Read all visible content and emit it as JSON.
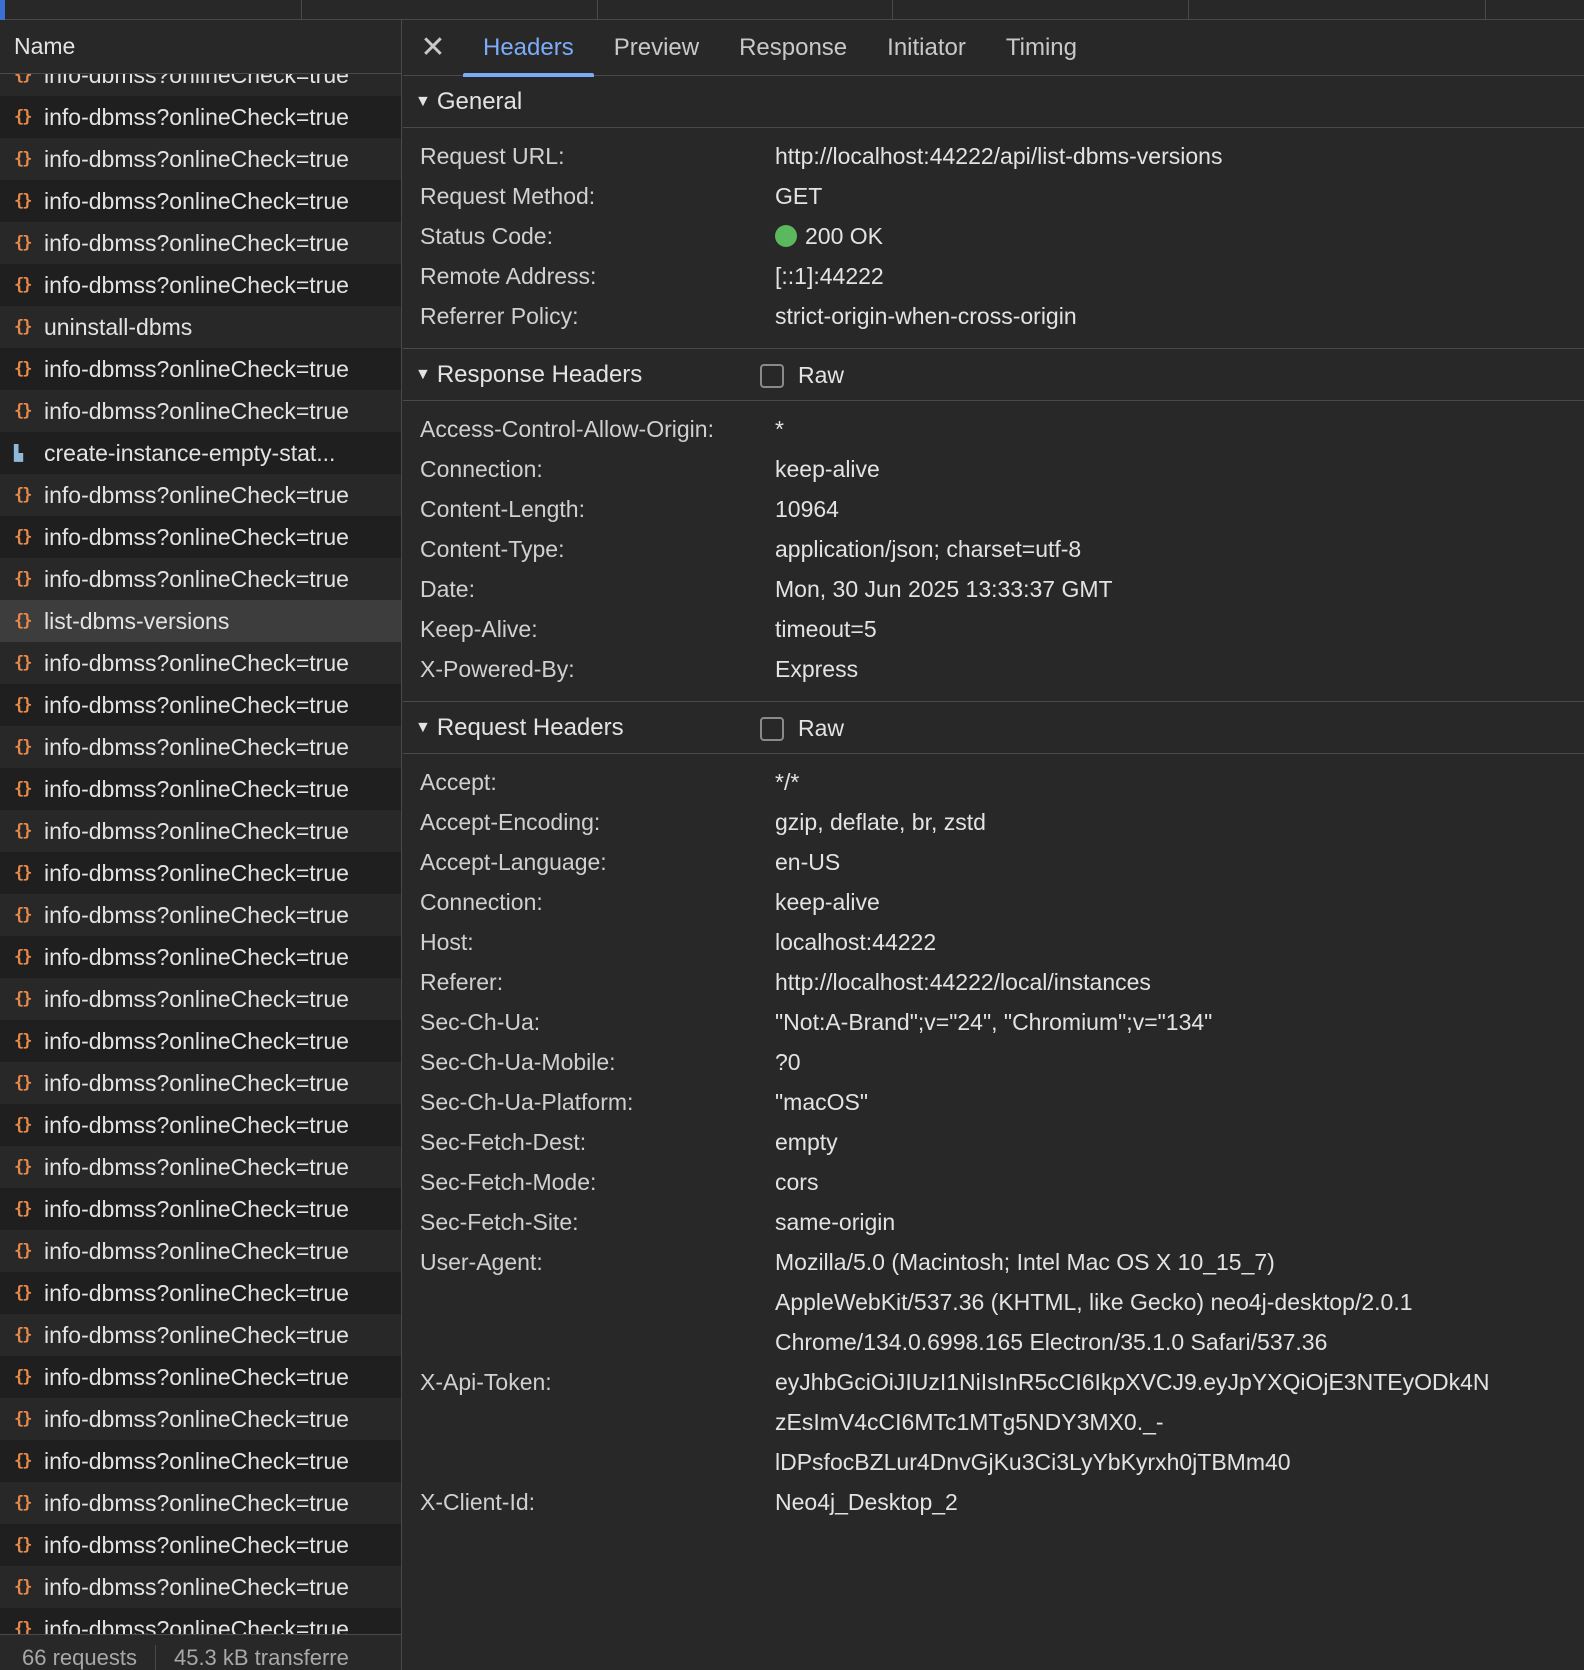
{
  "list": {
    "header": "Name",
    "partial_top": "info-dbmss?onlineCheck=true",
    "rows": [
      {
        "label": "info-dbmss?onlineCheck=true",
        "icon": "json-icon"
      },
      {
        "label": "info-dbmss?onlineCheck=true",
        "icon": "json-icon"
      },
      {
        "label": "info-dbmss?onlineCheck=true",
        "icon": "json-icon"
      },
      {
        "label": "info-dbmss?onlineCheck=true",
        "icon": "json-icon"
      },
      {
        "label": "info-dbmss?onlineCheck=true",
        "icon": "json-icon"
      },
      {
        "label": "uninstall-dbms",
        "icon": "json-icon"
      },
      {
        "label": "info-dbmss?onlineCheck=true",
        "icon": "json-icon"
      },
      {
        "label": "info-dbmss?onlineCheck=true",
        "icon": "json-icon"
      },
      {
        "label": "create-instance-empty-stat...",
        "icon": "document-icon"
      },
      {
        "label": "info-dbmss?onlineCheck=true",
        "icon": "json-icon"
      },
      {
        "label": "info-dbmss?onlineCheck=true",
        "icon": "json-icon"
      },
      {
        "label": "info-dbmss?onlineCheck=true",
        "icon": "json-icon"
      },
      {
        "label": "list-dbms-versions",
        "icon": "json-icon",
        "selected": true
      },
      {
        "label": "info-dbmss?onlineCheck=true",
        "icon": "json-icon"
      },
      {
        "label": "info-dbmss?onlineCheck=true",
        "icon": "json-icon"
      },
      {
        "label": "info-dbmss?onlineCheck=true",
        "icon": "json-icon"
      },
      {
        "label": "info-dbmss?onlineCheck=true",
        "icon": "json-icon"
      },
      {
        "label": "info-dbmss?onlineCheck=true",
        "icon": "json-icon"
      },
      {
        "label": "info-dbmss?onlineCheck=true",
        "icon": "json-icon"
      },
      {
        "label": "info-dbmss?onlineCheck=true",
        "icon": "json-icon"
      },
      {
        "label": "info-dbmss?onlineCheck=true",
        "icon": "json-icon"
      },
      {
        "label": "info-dbmss?onlineCheck=true",
        "icon": "json-icon"
      },
      {
        "label": "info-dbmss?onlineCheck=true",
        "icon": "json-icon"
      },
      {
        "label": "info-dbmss?onlineCheck=true",
        "icon": "json-icon"
      },
      {
        "label": "info-dbmss?onlineCheck=true",
        "icon": "json-icon"
      },
      {
        "label": "info-dbmss?onlineCheck=true",
        "icon": "json-icon"
      },
      {
        "label": "info-dbmss?onlineCheck=true",
        "icon": "json-icon"
      },
      {
        "label": "info-dbmss?onlineCheck=true",
        "icon": "json-icon"
      },
      {
        "label": "info-dbmss?onlineCheck=true",
        "icon": "json-icon"
      },
      {
        "label": "info-dbmss?onlineCheck=true",
        "icon": "json-icon"
      },
      {
        "label": "info-dbmss?onlineCheck=true",
        "icon": "json-icon"
      },
      {
        "label": "info-dbmss?onlineCheck=true",
        "icon": "json-icon"
      },
      {
        "label": "info-dbmss?onlineCheck=true",
        "icon": "json-icon"
      },
      {
        "label": "info-dbmss?onlineCheck=true",
        "icon": "json-icon"
      },
      {
        "label": "info-dbmss?onlineCheck=true",
        "icon": "json-icon"
      },
      {
        "label": "info-dbmss?onlineCheck=true",
        "icon": "json-icon"
      },
      {
        "label": "info-dbmss?onlineCheck=true",
        "icon": "json-icon"
      }
    ],
    "status": {
      "requests": "66 requests",
      "transferred": "45.3 kB transferre"
    }
  },
  "tabs": [
    {
      "label": "Headers",
      "active": true
    },
    {
      "label": "Preview"
    },
    {
      "label": "Response"
    },
    {
      "label": "Initiator"
    },
    {
      "label": "Timing"
    }
  ],
  "general": {
    "title": "General",
    "rows": [
      {
        "key": "Request URL:",
        "value": [
          "http://localhost:44222/api/list-dbms-versions"
        ]
      },
      {
        "key": "Request Method:",
        "value": [
          "GET"
        ]
      },
      {
        "key": "Status Code:",
        "value": [
          "200 OK"
        ],
        "status_dot": "#5cb85c"
      },
      {
        "key": "Remote Address:",
        "value": [
          "[::1]:44222"
        ]
      },
      {
        "key": "Referrer Policy:",
        "value": [
          "strict-origin-when-cross-origin"
        ]
      }
    ]
  },
  "response_headers": {
    "title": "Response Headers",
    "raw_label": "Raw",
    "raw_checked": false,
    "rows": [
      {
        "key": "Access-Control-Allow-Origin:",
        "value": [
          "*"
        ]
      },
      {
        "key": "Connection:",
        "value": [
          "keep-alive"
        ]
      },
      {
        "key": "Content-Length:",
        "value": [
          "10964"
        ]
      },
      {
        "key": "Content-Type:",
        "value": [
          "application/json; charset=utf-8"
        ]
      },
      {
        "key": "Date:",
        "value": [
          "Mon, 30 Jun 2025 13:33:37 GMT"
        ]
      },
      {
        "key": "Keep-Alive:",
        "value": [
          "timeout=5"
        ]
      },
      {
        "key": "X-Powered-By:",
        "value": [
          "Express"
        ]
      }
    ]
  },
  "request_headers": {
    "title": "Request Headers",
    "raw_label": "Raw",
    "raw_checked": false,
    "rows": [
      {
        "key": "Accept:",
        "value": [
          "*/*"
        ]
      },
      {
        "key": "Accept-Encoding:",
        "value": [
          "gzip, deflate, br, zstd"
        ]
      },
      {
        "key": "Accept-Language:",
        "value": [
          "en-US"
        ]
      },
      {
        "key": "Connection:",
        "value": [
          "keep-alive"
        ]
      },
      {
        "key": "Host:",
        "value": [
          "localhost:44222"
        ]
      },
      {
        "key": "Referer:",
        "value": [
          "http://localhost:44222/local/instances"
        ]
      },
      {
        "key": "Sec-Ch-Ua:",
        "value": [
          "\"Not:A-Brand\";v=\"24\", \"Chromium\";v=\"134\""
        ]
      },
      {
        "key": "Sec-Ch-Ua-Mobile:",
        "value": [
          "?0"
        ]
      },
      {
        "key": "Sec-Ch-Ua-Platform:",
        "value": [
          "\"macOS\""
        ]
      },
      {
        "key": "Sec-Fetch-Dest:",
        "value": [
          "empty"
        ]
      },
      {
        "key": "Sec-Fetch-Mode:",
        "value": [
          "cors"
        ]
      },
      {
        "key": "Sec-Fetch-Site:",
        "value": [
          "same-origin"
        ]
      },
      {
        "key": "User-Agent:",
        "value": [
          "Mozilla/5.0 (Macintosh; Intel Mac OS X 10_15_7)",
          "AppleWebKit/537.36 (KHTML, like Gecko) neo4j-desktop/2.0.1",
          "Chrome/134.0.6998.165 Electron/35.1.0 Safari/537.36"
        ]
      },
      {
        "key": "X-Api-Token:",
        "value": [
          "eyJhbGciOiJIUzI1NiIsInR5cCI6IkpXVCJ9.eyJpYXQiOjE3NTEyODk4N",
          "zEsImV4cCI6MTc1MTg5NDY3MX0._-",
          "lDPsfocBZLur4DnvGjKu3Ci3LyYbKyrxh0jTBMm40"
        ]
      },
      {
        "key": "X-Client-Id:",
        "value": [
          "Neo4j_Desktop_2"
        ]
      }
    ]
  },
  "colors": {
    "accent": "#7cacf8",
    "json_icon": "#e8894c",
    "status_ok": "#5cb85c"
  }
}
